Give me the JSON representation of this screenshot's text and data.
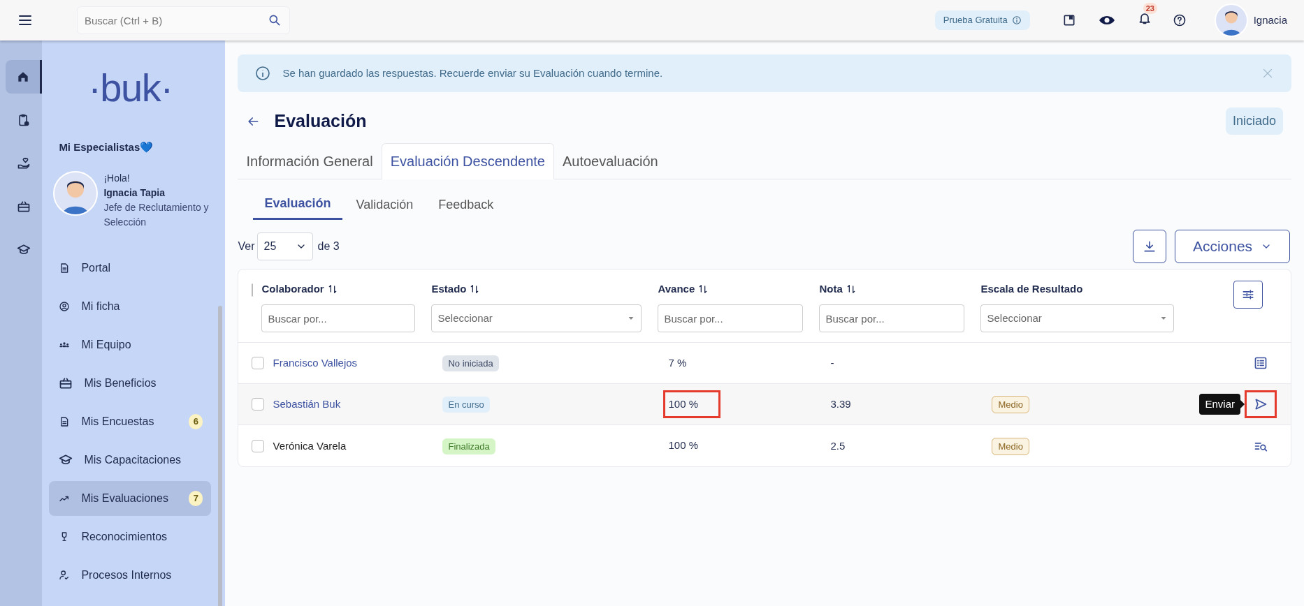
{
  "top_bar": {
    "search": {
      "placeholder": "Buscar (Ctrl + B)"
    },
    "trial_badge": "Prueba Gratuita",
    "notifications_count": "23",
    "user_name": "Ignacia"
  },
  "rail": [
    {
      "kind": "home",
      "selected": true
    },
    {
      "kind": "clipboard",
      "selected": false
    },
    {
      "kind": "care",
      "selected": false
    },
    {
      "kind": "gift",
      "selected": false
    },
    {
      "kind": "cap",
      "selected": false
    }
  ],
  "sidebar": {
    "logo": "·buk·",
    "company": "Mi Especialistas💙",
    "greeting": "¡Hola!",
    "user": "Ignacia Tapia",
    "role": "Jefe de Reclutamiento y Selección",
    "items": [
      {
        "label": "Portal",
        "kind": "doc",
        "selected": false
      },
      {
        "label": "Mi ficha",
        "kind": "user",
        "selected": false
      },
      {
        "label": "Mi Equipo",
        "kind": "team",
        "selected": false
      },
      {
        "label": "Mis Beneficios",
        "kind": "gift",
        "selected": false
      },
      {
        "label": "Mis Encuestas",
        "kind": "doc",
        "selected": false,
        "badge": "6"
      },
      {
        "label": "Mis Capacitaciones",
        "kind": "cap",
        "selected": false
      },
      {
        "label": "Mis Evaluaciones",
        "kind": "trend",
        "selected": true,
        "badge": "7"
      },
      {
        "label": "Reconocimientos",
        "kind": "trophy",
        "selected": false
      },
      {
        "label": "Procesos Internos",
        "kind": "person",
        "selected": false
      }
    ]
  },
  "alert": "Se han guardado las respuestas. Recuerde enviar su Evaluación cuando termine.",
  "title": "Evaluación",
  "status": "Iniciado",
  "tabs": [
    {
      "label": "Información General",
      "selected": false
    },
    {
      "label": "Evaluación Descendente",
      "selected": true
    },
    {
      "label": "Autoevaluación",
      "selected": false
    }
  ],
  "subtabs": [
    {
      "label": "Evaluación",
      "selected": true
    },
    {
      "label": "Validación",
      "selected": false
    },
    {
      "label": "Feedback",
      "selected": false
    }
  ],
  "pager": {
    "label": "Ver",
    "page_size": "25",
    "total": "de 3"
  },
  "actions_button": "Acciones",
  "table": {
    "all_checked": false,
    "columns": [
      {
        "label": "Colaborador",
        "kind": "text",
        "placeholder": "Buscar por..."
      },
      {
        "label": "Estado",
        "kind": "select",
        "placeholder": "Seleccionar"
      },
      {
        "label": "Avance",
        "kind": "text",
        "placeholder": "Buscar por..."
      },
      {
        "label": "Nota",
        "kind": "text",
        "placeholder": "Buscar por..."
      },
      {
        "label": "Escala de Resultado",
        "kind": "select",
        "placeholder": "Seleccionar"
      }
    ],
    "rows": [
      {
        "name": "Francisco Vallejos",
        "link": true,
        "status": {
          "label": "No iniciada",
          "kind": "pending"
        },
        "progress": "7 %",
        "progress_highlighted": false,
        "grade": "-",
        "action": {
          "kind": "list",
          "highlighted": false
        },
        "hovered": false,
        "checked": false
      },
      {
        "name": "Sebastián Buk",
        "link": true,
        "status": {
          "label": "En curso",
          "kind": "active"
        },
        "progress": "100 %",
        "progress_highlighted": true,
        "grade": "3.39",
        "scale": "Medio",
        "action": {
          "kind": "send",
          "highlighted": true,
          "tooltip": "Enviar"
        },
        "hovered": true,
        "checked": false
      },
      {
        "name": "Verónica Varela",
        "link": false,
        "status": {
          "label": "Finalizada",
          "kind": "done"
        },
        "progress": "100 %",
        "progress_highlighted": false,
        "grade": "2.5",
        "scale": "Medio",
        "action": {
          "kind": "review",
          "highlighted": false
        },
        "hovered": false,
        "checked": false
      }
    ]
  }
}
